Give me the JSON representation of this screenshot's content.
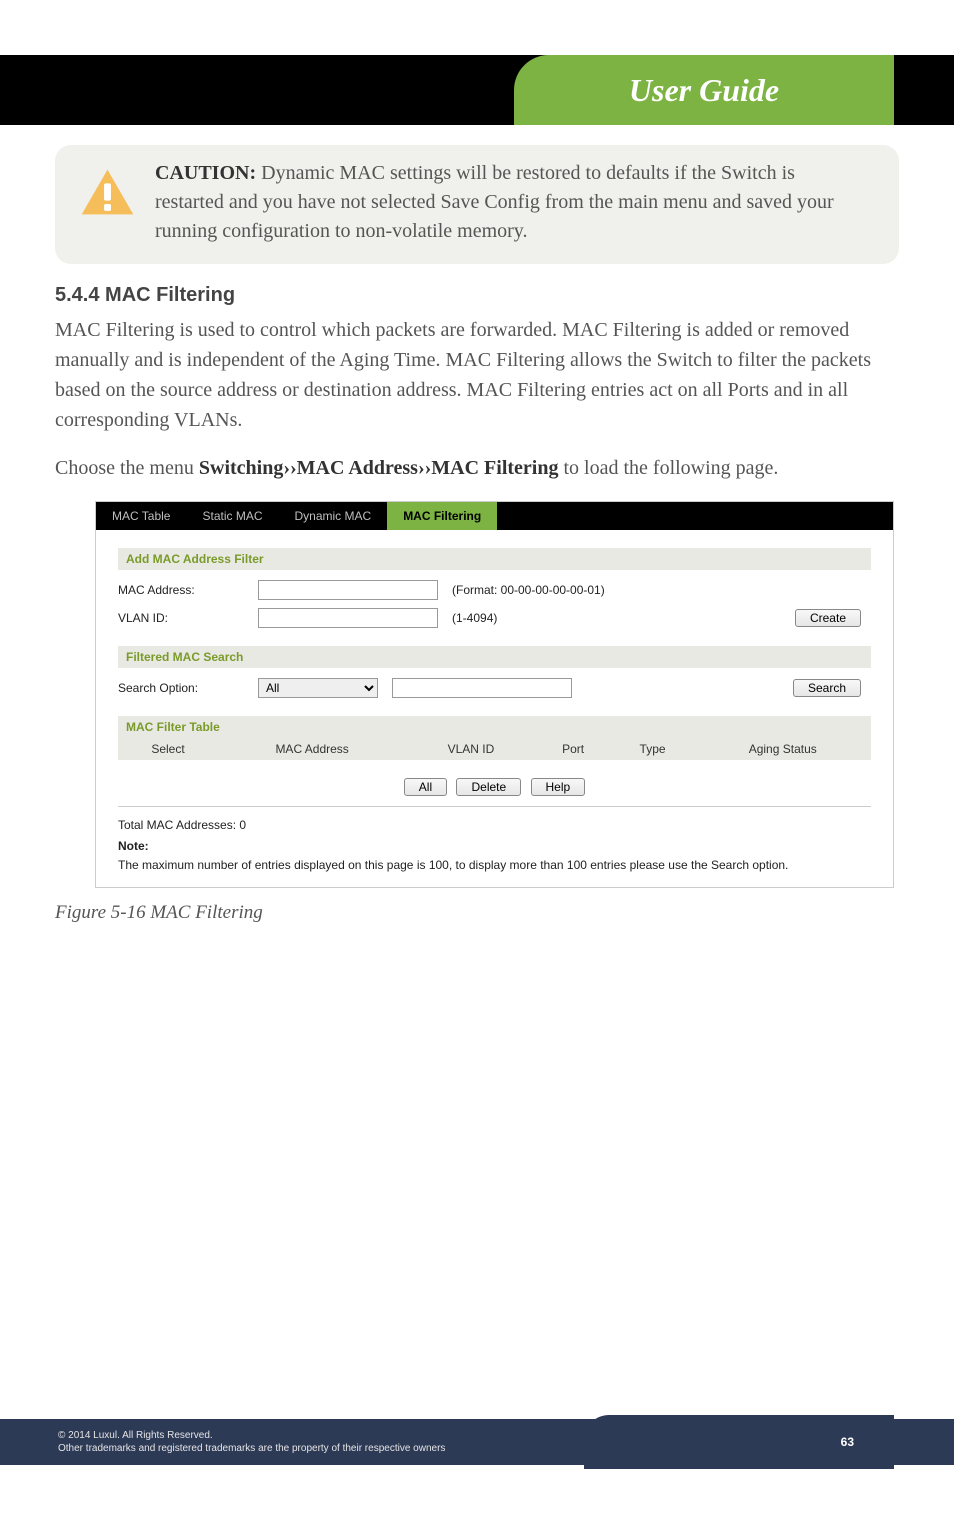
{
  "header": {
    "title": "User Guide"
  },
  "caution": {
    "label": "CAUTION:",
    "text": "Dynamic MAC settings will be restored to defaults if the Switch is restarted and you have not selected Save Config from the main menu and saved your running configuration to non-volatile memory."
  },
  "section": {
    "heading": "5.4.4 MAC Filtering"
  },
  "para1": "MAC Filtering is used to control which packets are forwarded. MAC Filtering is added or removed manually and is independent of the Aging Time. MAC Filtering allows the Switch to filter the packets based on the source address or destination address. MAC Filtering entries act on all Ports and in all corresponding VLANs.",
  "para2_pre": "Choose the menu ",
  "para2_bold": "Switching››MAC Address››MAC Filtering",
  "para2_post": " to load the following page.",
  "ui": {
    "tabs": {
      "t0": "MAC Table",
      "t1": "Static MAC",
      "t2": "Dynamic MAC",
      "t3": "MAC Filtering"
    },
    "add_section": "Add MAC Address Filter",
    "mac_label": "MAC Address:",
    "mac_format": "(Format: 00-00-00-00-00-01)",
    "vlan_label": "VLAN ID:",
    "vlan_hint": "(1-4094)",
    "create_btn": "Create",
    "search_section": "Filtered MAC Search",
    "search_label": "Search Option:",
    "search_option": "All",
    "search_btn": "Search",
    "table_section": "MAC Filter Table",
    "cols": {
      "c0": "Select",
      "c1": "MAC Address",
      "c2": "VLAN ID",
      "c3": "Port",
      "c4": "Type",
      "c5": "Aging Status"
    },
    "btn_all": "All",
    "btn_delete": "Delete",
    "btn_help": "Help",
    "total": "Total MAC Addresses: 0",
    "note_label": "Note:",
    "note_text": "The maximum number of entries displayed on this page is 100, to display more than 100 entries please use the Search option."
  },
  "figure_caption": "Figure 5-16 MAC Filtering",
  "footer": {
    "line1": "© 2014  Luxul. All Rights Reserved.",
    "line2": "Other trademarks and registered trademarks are the property of their respective owners",
    "page": "63"
  }
}
